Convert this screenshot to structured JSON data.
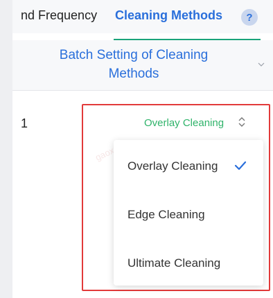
{
  "header": {
    "col_frequency": "nd Frequency",
    "col_cleaning_methods": "Cleaning Methods",
    "help_icon": "?"
  },
  "batch": {
    "label": "Batch Setting of Cleaning Methods"
  },
  "row": {
    "index": "1",
    "selected_value": "Overlay Cleaning"
  },
  "watermark": "gaoxuan",
  "dropdown": {
    "options": [
      "Overlay Cleaning",
      "Edge Cleaning",
      "Ultimate Cleaning"
    ],
    "selected_index": 0
  },
  "colors": {
    "accent_blue": "#2a6fdb",
    "selected_green": "#2fb36a",
    "highlight_red": "#e23a3a"
  },
  "icons": {
    "help": "question-icon",
    "collapse": "chevron-down-icon",
    "select": "sort-arrows-icon",
    "selected": "check-icon"
  }
}
